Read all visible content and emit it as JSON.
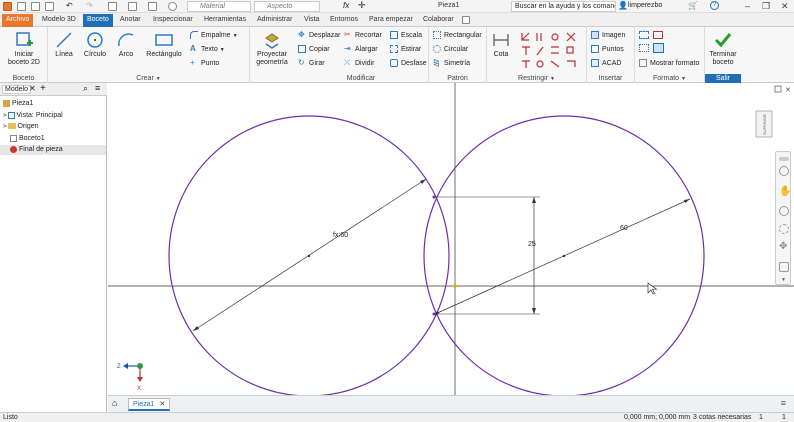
{
  "titlebar": {
    "material_placeholder": "Material",
    "appearance_placeholder": "Aspecto",
    "fx_label": "fx",
    "document_title": "Pieza1",
    "search_text": "Buscar en la ayuda y los comandos",
    "user_name": "limperezbo"
  },
  "tabs": [
    "Archivo",
    "Modelo 3D",
    "Boceto",
    "Anotar",
    "Inspeccionar",
    "Herramientas",
    "Administrar",
    "Vista",
    "Entornos",
    "Para empezar",
    "Colaborar"
  ],
  "ribbon": {
    "boceto_group": {
      "label": "Boceto",
      "start_sketch": "Iniciar\nboceto 2D"
    },
    "crear_group": {
      "label": "Crear",
      "linea": "Línea",
      "circulo": "Círculo",
      "arco": "Arco",
      "rectangulo": "Rectángulo",
      "empalme": "Empalme",
      "texto": "Texto",
      "punto": "Punto"
    },
    "proyectar": "Proyectar\ngeometría",
    "modificar_group": {
      "label": "Modificar",
      "desplazar": "Desplazar",
      "copiar": "Copiar",
      "girar": "Girar",
      "recortar": "Recortar",
      "alargar": "Alargar",
      "dividir": "Dividir",
      "escala": "Escala",
      "estirar": "Estirar",
      "desfase": "Desfase"
    },
    "patron_group": {
      "label": "Patrón",
      "rectangular": "Rectangular",
      "circular": "Circular",
      "simetria": "Simetría"
    },
    "restringir_group": {
      "label": "Restringir",
      "cota": "Cota"
    },
    "insertar_group": {
      "label": "Insertar",
      "imagen": "Imagen",
      "puntos": "Puntos",
      "acad": "ACAD"
    },
    "formato_group": {
      "label": "Formato",
      "mostrar_formato": "Mostrar formato"
    },
    "salir_group": {
      "label": "Salir",
      "terminar": "Terminar\nboceto"
    }
  },
  "browser": {
    "tab_label": "Modelo",
    "items": [
      "Pieza1",
      "Vista: Principal",
      "Origen",
      "Boceto1",
      "Final de pieza"
    ]
  },
  "canvas": {
    "dim_left": "fx:60",
    "dim_right": "60",
    "dim_vertical": "25",
    "axis_x_label": "X",
    "axis_z_label": "Z",
    "view_cube_label": "SUPERIOR"
  },
  "doc_tab": "Pieza1",
  "status": {
    "left": "Listo",
    "coords": "0,000 mm, 0,000 mm",
    "constraints": "3 cotas necesarias",
    "count1": "1",
    "count2": "1"
  },
  "colors": {
    "accent": "#1f6fb5",
    "file_tab": "#e8762d",
    "sketch_curve": "#6b2fb0"
  }
}
